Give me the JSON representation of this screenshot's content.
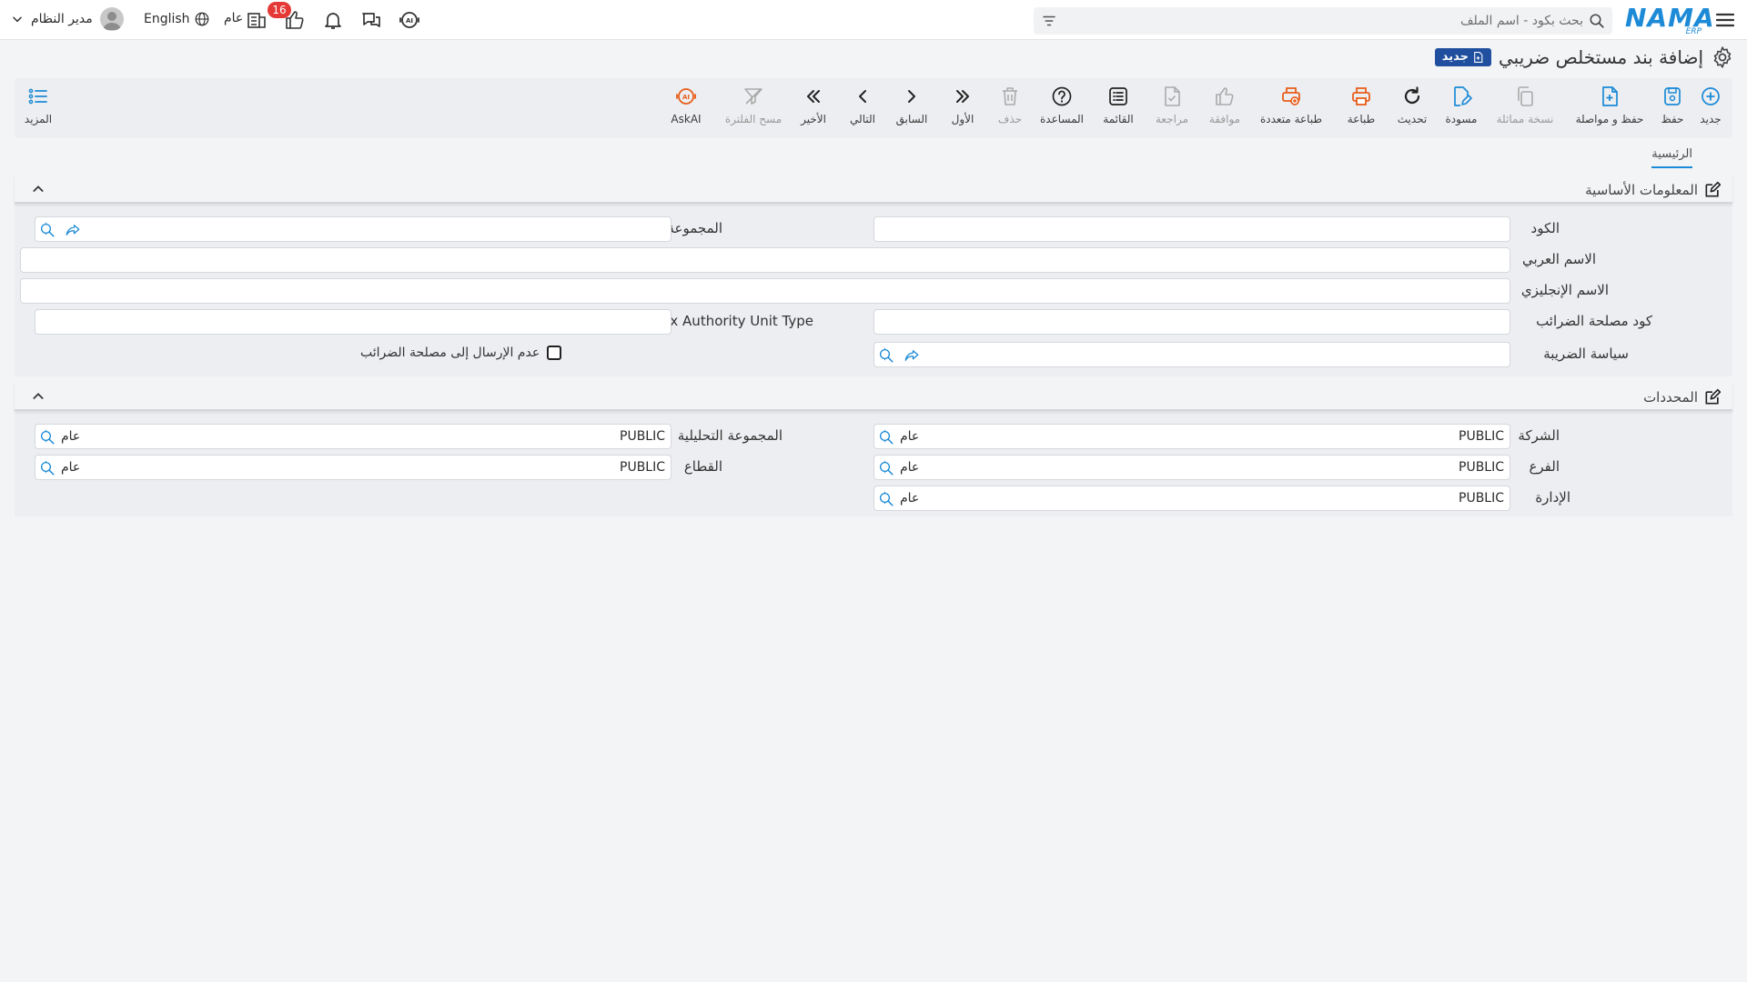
{
  "header": {
    "logo_text": "NAMA",
    "logo_sub": "ERP",
    "search_placeholder": "بحث بكود - اسم الملف",
    "notification_count": "16",
    "fiscal_label": "عام",
    "language_label": "English",
    "user_name": "مدير النظام"
  },
  "page": {
    "title": "إضافة بند مستخلص ضريبي",
    "status_badge": "جديد"
  },
  "toolbar": {
    "items": [
      {
        "label": "جديد",
        "icon": "plus-circle-icon"
      },
      {
        "label": "حفظ",
        "icon": "save-icon"
      },
      {
        "label": "حفظ و مواصلة",
        "icon": "file-plus-icon"
      },
      {
        "label": "نسخة مماثلة",
        "icon": "copy-icon"
      },
      {
        "label": "مسودة",
        "icon": "draft-icon"
      },
      {
        "label": "تحديث",
        "icon": "refresh-icon"
      },
      {
        "label": "طباعة",
        "icon": "print-icon"
      },
      {
        "label": "طباعة متعددة",
        "icon": "multi-print-icon"
      },
      {
        "label": "موافقة",
        "icon": "thumbs-up-icon"
      },
      {
        "label": "مراجعة",
        "icon": "review-icon"
      },
      {
        "label": "القائمة",
        "icon": "list-icon"
      },
      {
        "label": "المساعدة",
        "icon": "help-icon"
      },
      {
        "label": "حذف",
        "icon": "trash-icon"
      },
      {
        "label": "الأول",
        "icon": "first-icon"
      },
      {
        "label": "السابق",
        "icon": "prev-icon"
      },
      {
        "label": "التالي",
        "icon": "next-icon"
      },
      {
        "label": "الأخير",
        "icon": "last-icon"
      },
      {
        "label": "مسح الفلترة",
        "icon": "clear-filter-icon"
      },
      {
        "label": "AskAI",
        "icon": "ai-assistant-icon"
      },
      {
        "label": "المزيد",
        "icon": "more-icon"
      }
    ]
  },
  "tabs": {
    "main": "الرئيسية"
  },
  "basic_info": {
    "title": "المعلومات الأساسية",
    "code_label": "الكود",
    "group_label": "المجموعة",
    "arabic_name_label": "الاسم العربي",
    "english_name_label": "الاسم الإنجليزي",
    "tax_code_label": "كود مصلحة الضرائب",
    "tax_unit_type_label": "Tax Authority Unit Type",
    "tax_policy_label": "سياسة الضريبة",
    "no_send_label": "عدم الإرسال إلى مصلحة الضرائب"
  },
  "dimensions": {
    "title": "المحددات",
    "company_label": "الشركة",
    "company_value": "PUBLIC",
    "company_name": "عام",
    "analytic_group_label": "المجموعة التحليلية",
    "analytic_group_value": "PUBLIC",
    "analytic_group_name": "عام",
    "branch_label": "الفرع",
    "branch_value": "PUBLIC",
    "branch_name": "عام",
    "sector_label": "القطاع",
    "sector_value": "PUBLIC",
    "sector_name": "عام",
    "department_label": "الإدارة",
    "department_value": "PUBLIC",
    "department_name": "عام"
  },
  "colors": {
    "accent_blue": "#1c8ad6",
    "print_orange": "#e85d1a",
    "badge_red": "#e53935",
    "badge_navy": "#1f4f9e"
  }
}
